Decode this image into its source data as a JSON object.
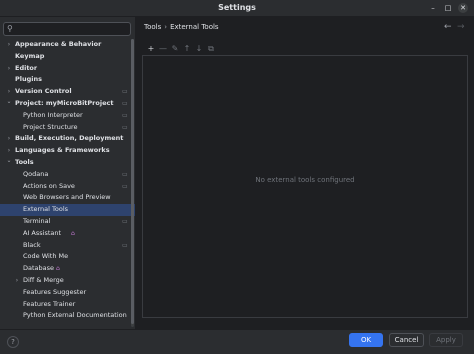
{
  "window": {
    "title": "Settings"
  },
  "search": {
    "placeholder": "",
    "value": ""
  },
  "sidebar": {
    "items": [
      {
        "label": "Appearance & Behavior",
        "expanded": false,
        "has_children": true,
        "level": 0,
        "bold": true
      },
      {
        "label": "Keymap",
        "level": 0,
        "bold": true
      },
      {
        "label": "Editor",
        "expanded": false,
        "has_children": true,
        "level": 0,
        "bold": true
      },
      {
        "label": "Plugins",
        "level": 0,
        "bold": true
      },
      {
        "label": "Version Control",
        "expanded": false,
        "has_children": true,
        "level": 0,
        "bold": true,
        "project_marker": true
      },
      {
        "label": "Project: myMicroBitProject",
        "expanded": true,
        "has_children": true,
        "level": 0,
        "bold": true,
        "project_marker": true
      },
      {
        "label": "Python Interpreter",
        "level": 1,
        "project_marker": true
      },
      {
        "label": "Project Structure",
        "level": 1,
        "project_marker": true
      },
      {
        "label": "Build, Execution, Deployment",
        "expanded": false,
        "has_children": true,
        "level": 0,
        "bold": true
      },
      {
        "label": "Languages & Frameworks",
        "expanded": false,
        "has_children": true,
        "level": 0,
        "bold": true
      },
      {
        "label": "Tools",
        "expanded": true,
        "has_children": true,
        "level": 0,
        "bold": true
      },
      {
        "label": "Qodana",
        "level": 1,
        "project_marker": true
      },
      {
        "label": "Actions on Save",
        "level": 1,
        "project_marker": true
      },
      {
        "label": "Web Browsers and Preview",
        "level": 1
      },
      {
        "label": "External Tools",
        "level": 1,
        "selected": true
      },
      {
        "label": "Terminal",
        "level": 1,
        "project_marker": true
      },
      {
        "label": "AI Assistant",
        "level": 1,
        "locked": true
      },
      {
        "label": "Black",
        "level": 1,
        "project_marker": true
      },
      {
        "label": "Code With Me",
        "level": 1
      },
      {
        "label": "Database",
        "level": 1,
        "locked": true
      },
      {
        "label": "Diff & Merge",
        "expanded": false,
        "has_children": true,
        "level": 1
      },
      {
        "label": "Features Suggester",
        "level": 1
      },
      {
        "label": "Features Trainer",
        "level": 1
      },
      {
        "label": "Python External Documentation",
        "level": 1
      }
    ]
  },
  "main": {
    "breadcrumb": [
      "Tools",
      "External Tools"
    ],
    "empty_text": "No external tools configured",
    "toolbar": [
      "add-icon",
      "remove-icon",
      "edit-icon",
      "move-up-icon",
      "move-down-icon",
      "copy-icon"
    ]
  },
  "footer": {
    "help": "?",
    "ok": "OK",
    "cancel": "Cancel",
    "apply": "Apply"
  },
  "colors": {
    "accent": "#3574f0",
    "selection": "#2e436e",
    "sidebar_bg": "#2b2d30",
    "content_bg": "#1e1f22",
    "lock": "#c57ad4"
  }
}
